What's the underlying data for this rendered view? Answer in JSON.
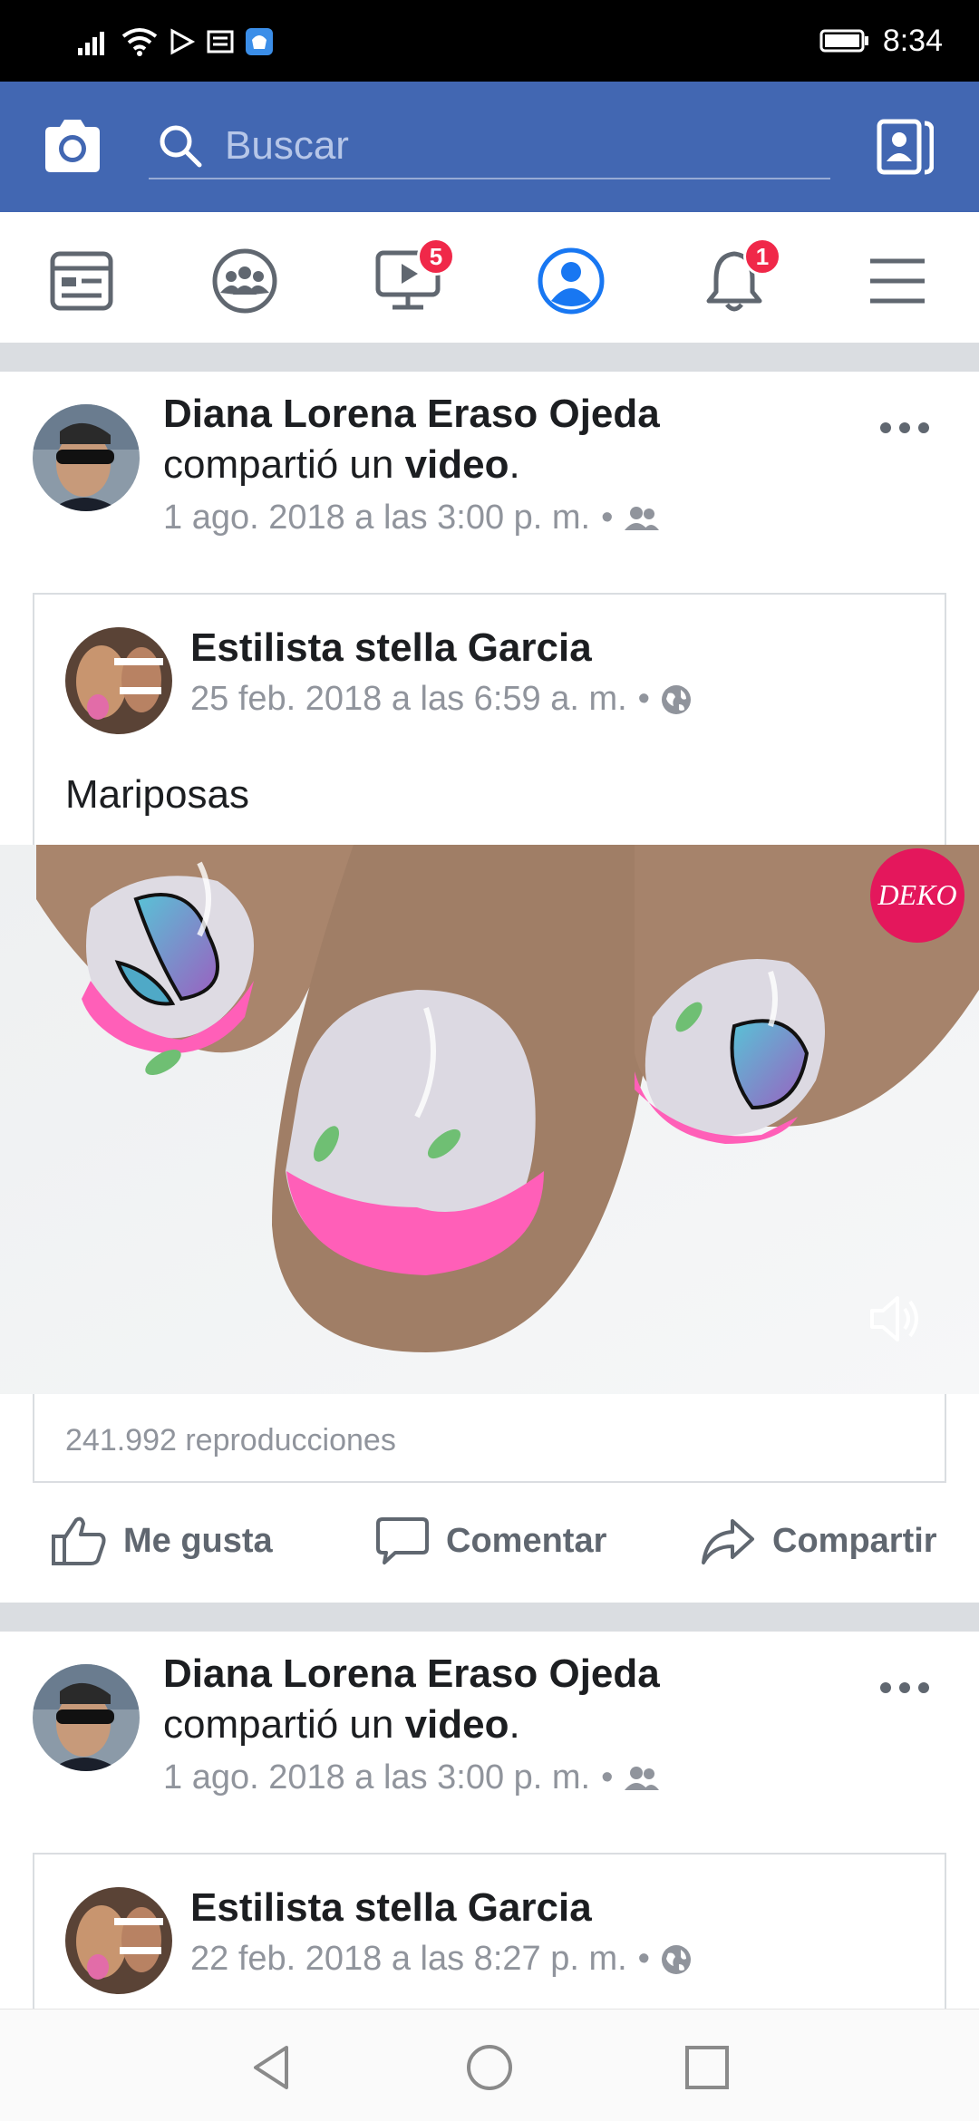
{
  "status_bar": {
    "time": "8:34"
  },
  "header": {
    "search_placeholder": "Buscar"
  },
  "nav": {
    "video_badge": "5",
    "notifications_badge": "1"
  },
  "posts": [
    {
      "author": "Diana Lorena Eraso Ojeda",
      "shared_prefix": "compartió un ",
      "shared_object": "video",
      "shared_suffix": ".",
      "time": "1 ago. 2018 a las 3:00 p. m.",
      "separator": "•",
      "inner": {
        "author": "Estilista  stella Garcia",
        "time": "25 feb. 2018 a las 6:59 a. m.",
        "separator": "•",
        "caption": "Mariposas",
        "watermark": "DEKO",
        "views": "241.992 reproducciones"
      },
      "actions": {
        "like": "Me gusta",
        "comment": "Comentar",
        "share": "Compartir"
      }
    },
    {
      "author": "Diana Lorena Eraso Ojeda",
      "shared_prefix": "compartió un ",
      "shared_object": "video",
      "shared_suffix": ".",
      "time": "1 ago. 2018 a las 3:00 p. m.",
      "separator": "•",
      "inner": {
        "author": "Estilista  stella Garcia",
        "time": "22 feb. 2018 a las 8:27 p. m.",
        "separator": "•"
      }
    }
  ],
  "colors": {
    "facebook_blue": "#4267b2",
    "badge_red": "#f02849",
    "active_blue": "#1877f2"
  }
}
